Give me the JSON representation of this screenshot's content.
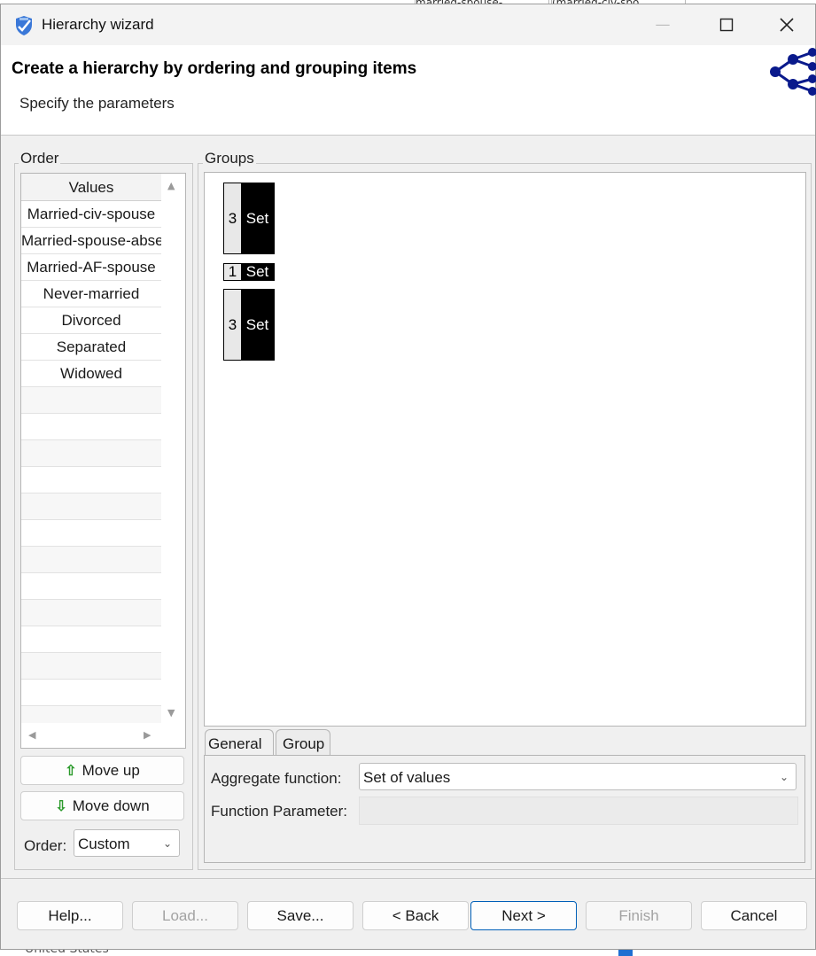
{
  "background": {
    "top_cells": [
      "married-spouse-...",
      "(married-civ-spo..."
    ],
    "bottom_text": "United States"
  },
  "window": {
    "title": "Hierarchy wizard",
    "controls": {
      "minimize": "—",
      "maximize": "□",
      "close": "✕"
    }
  },
  "header": {
    "title": "Create a hierarchy by ordering and grouping items",
    "subtitle": "Specify the parameters"
  },
  "order_panel": {
    "label": "Order",
    "column_header": "Values",
    "rows": [
      "Married-civ-spouse",
      "Married-spouse-absent",
      "Married-AF-spouse",
      "Never-married",
      "Divorced",
      "Separated",
      "Widowed"
    ],
    "move_up": "Move up",
    "move_down": "Move down",
    "order_label": "Order:",
    "order_value": "Custom"
  },
  "groups_panel": {
    "label": "Groups",
    "groups": [
      {
        "count": "3",
        "label": "Set"
      },
      {
        "count": "1",
        "label": "Set"
      },
      {
        "count": "3",
        "label": "Set"
      }
    ]
  },
  "tabs": {
    "items": [
      "General",
      "Group"
    ],
    "active": "General",
    "aggregate_label": "Aggregate function:",
    "aggregate_value": "Set of values",
    "parameter_label": "Function Parameter:",
    "parameter_value": ""
  },
  "footer": {
    "help": "Help...",
    "load": "Load...",
    "save": "Save...",
    "back": "< Back",
    "next": "Next >",
    "finish": "Finish",
    "cancel": "Cancel"
  },
  "colors": {
    "accent": "#005fb8",
    "group_block": "#000000",
    "move_arrow": "#2c9a2c",
    "logo": "#0a1a8c"
  }
}
